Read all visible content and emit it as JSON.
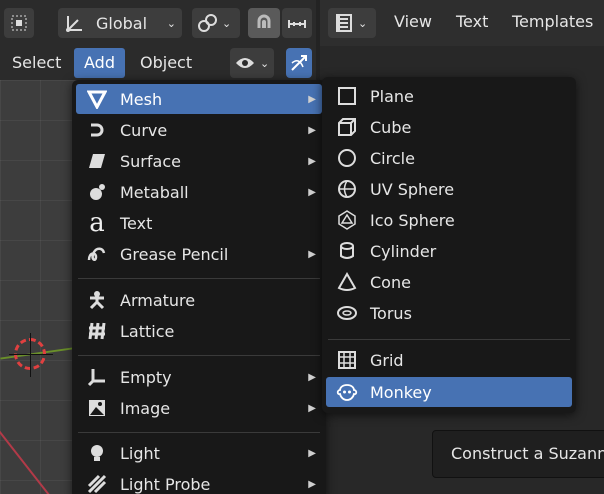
{
  "header": {
    "orientation_label": "Global",
    "transform_icon": "transform-orientation-icon",
    "snap_icon": "snap-icon",
    "proportional_icon": "proportional-edit-icon"
  },
  "right_header": {
    "editor_icon": "text-editor-icon",
    "view": "View",
    "text": "Text",
    "templates": "Templates"
  },
  "menubar": {
    "select": "Select",
    "add": "Add",
    "object": "Object"
  },
  "add_menu": {
    "items": [
      {
        "label": "Mesh",
        "icon": "mesh-icon",
        "submenu": true
      },
      {
        "label": "Curve",
        "icon": "curve-icon",
        "submenu": true
      },
      {
        "label": "Surface",
        "icon": "surface-icon",
        "submenu": true
      },
      {
        "label": "Metaball",
        "icon": "metaball-icon",
        "submenu": true
      },
      {
        "label": "Text",
        "icon": "text-object-icon",
        "submenu": false
      },
      {
        "label": "Grease Pencil",
        "icon": "grease-pencil-icon",
        "submenu": true
      },
      {
        "label": "Armature",
        "icon": "armature-icon",
        "submenu": false
      },
      {
        "label": "Lattice",
        "icon": "lattice-icon",
        "submenu": false
      },
      {
        "label": "Empty",
        "icon": "empty-icon",
        "submenu": true
      },
      {
        "label": "Image",
        "icon": "image-icon",
        "submenu": true
      },
      {
        "label": "Light",
        "icon": "light-icon",
        "submenu": true
      },
      {
        "label": "Light Probe",
        "icon": "light-probe-icon",
        "submenu": true
      }
    ]
  },
  "mesh_menu": {
    "items": [
      {
        "label": "Plane",
        "icon": "plane-icon"
      },
      {
        "label": "Cube",
        "icon": "cube-icon"
      },
      {
        "label": "Circle",
        "icon": "circle-icon"
      },
      {
        "label": "UV Sphere",
        "icon": "uv-sphere-icon"
      },
      {
        "label": "Ico Sphere",
        "icon": "ico-sphere-icon"
      },
      {
        "label": "Cylinder",
        "icon": "cylinder-icon"
      },
      {
        "label": "Cone",
        "icon": "cone-icon"
      },
      {
        "label": "Torus",
        "icon": "torus-icon"
      },
      {
        "label": "Grid",
        "icon": "grid-icon"
      },
      {
        "label": "Monkey",
        "icon": "monkey-icon"
      }
    ]
  },
  "tooltip": {
    "text": "Construct a Suzanne"
  },
  "colors": {
    "highlight": "#4772b3",
    "menu_bg": "#181818"
  }
}
